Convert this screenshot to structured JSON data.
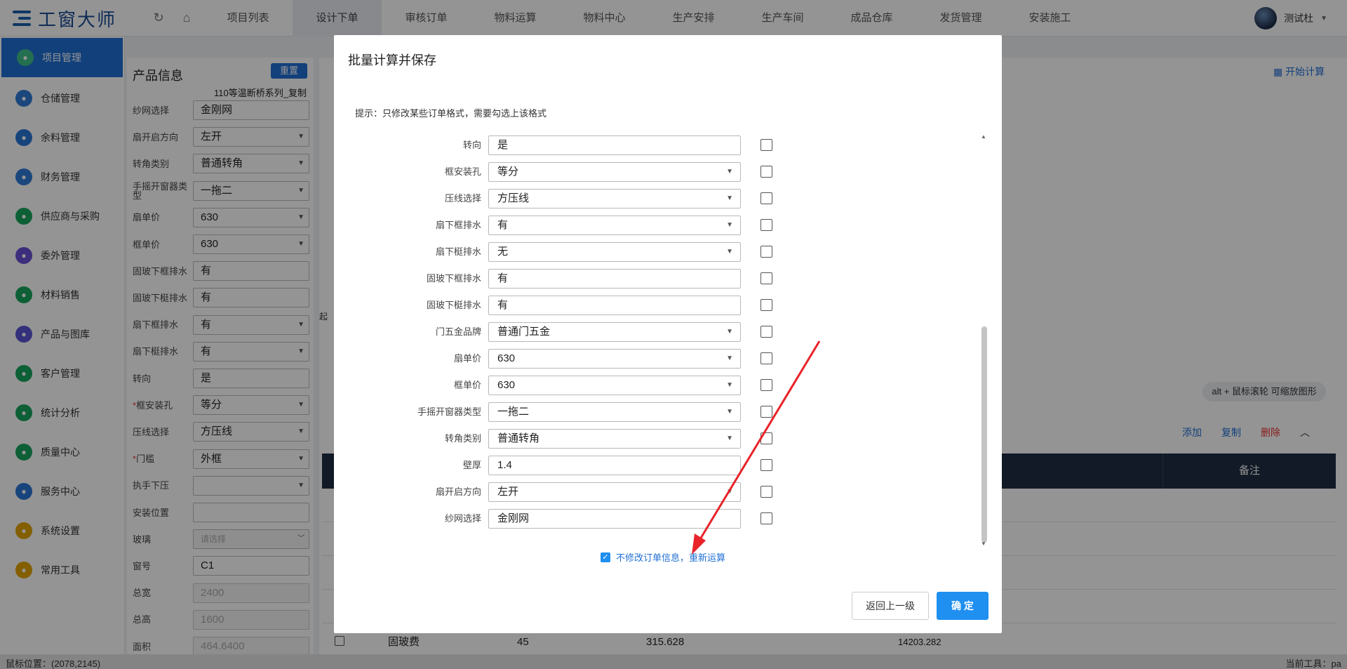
{
  "app": {
    "logo_text": "工窗大师"
  },
  "topnav": {
    "items": [
      "项目列表",
      "设计下单",
      "审核订单",
      "物料运算",
      "物料中心",
      "生产安排",
      "生产车间",
      "成品仓库",
      "发货管理",
      "安装施工"
    ],
    "user": "测试杜"
  },
  "sidebar": {
    "items": [
      {
        "label": "项目管理",
        "color": "#1aa06d"
      },
      {
        "label": "仓储管理",
        "color": "#2f7ad8"
      },
      {
        "label": "余料管理",
        "color": "#2a75d6"
      },
      {
        "label": "财务管理",
        "color": "#2f7ad8"
      },
      {
        "label": "供应商与采购",
        "color": "#18a45c"
      },
      {
        "label": "委外管理",
        "color": "#6a4fd6"
      },
      {
        "label": "材料销售",
        "color": "#18a45c"
      },
      {
        "label": "产品与图库",
        "color": "#5b54d6"
      },
      {
        "label": "客户管理",
        "color": "#18a45c"
      },
      {
        "label": "统计分析",
        "color": "#18a45c"
      },
      {
        "label": "质量中心",
        "color": "#18a45c"
      },
      {
        "label": "服务中心",
        "color": "#2a75d6"
      },
      {
        "label": "系统设置",
        "color": "#e2a400"
      },
      {
        "label": "常用工具",
        "color": "#e2a400"
      }
    ]
  },
  "panel": {
    "title": "产品信息",
    "reset": "重置",
    "series": "110等温断桥系列_复制",
    "fields": [
      {
        "label": "纱网选择",
        "value": "金刚网",
        "select": false
      },
      {
        "label": "扇开启方向",
        "value": "左开",
        "select": true
      },
      {
        "label": "转角类别",
        "value": "普通转角",
        "select": true
      },
      {
        "label": "手摇开窗器类型",
        "value": "一拖二",
        "select": true
      },
      {
        "label": "扇单价",
        "value": "630",
        "select": true
      },
      {
        "label": "框单价",
        "value": "630",
        "select": true
      },
      {
        "label": "固玻下框排水",
        "value": "有",
        "select": false
      },
      {
        "label": "固玻下梃排水",
        "value": "有",
        "select": false
      },
      {
        "label": "扇下框排水",
        "value": "有",
        "select": true
      },
      {
        "label": "扇下梃排水",
        "value": "有",
        "select": true
      },
      {
        "label": "转向",
        "value": "是",
        "select": false
      },
      {
        "label": "框安装孔",
        "value": "等分",
        "select": true,
        "required": true
      },
      {
        "label": "压线选择",
        "value": "方压线",
        "select": true
      },
      {
        "label": "门槛",
        "value": "外框",
        "select": true,
        "required": true
      },
      {
        "label": "执手下压",
        "value": "",
        "select": true
      },
      {
        "label": "安装位置",
        "value": "",
        "select": false
      },
      {
        "label": "玻璃",
        "value": "请选择",
        "select": true,
        "placeholder": true
      },
      {
        "label": "窗号",
        "value": "C1",
        "select": false
      },
      {
        "label": "总宽",
        "value": "2400",
        "select": false,
        "disabled": true
      },
      {
        "label": "总高",
        "value": "1600",
        "select": false,
        "disabled": true
      },
      {
        "label": "面积",
        "value": "464.6400",
        "select": false,
        "disabled": true
      }
    ]
  },
  "main": {
    "start_calc": "开始计算",
    "zoom_hint": "alt + 鼠标滚轮 可缩放图形",
    "actions": {
      "add": "添加",
      "copy": "复制",
      "delete": "删除"
    },
    "remark_header": "备注",
    "partial_label": "起",
    "bottom_row": {
      "name": "固玻费",
      "qty": "45",
      "price": "315.628",
      "total": "14203.282"
    }
  },
  "status": {
    "mouse": "鼠标位置：(2078,2145)",
    "tool": "当前工具：pa"
  },
  "modal": {
    "title": "批量计算并保存",
    "hint": "提示：只修改某些订单格式，需要勾选上该格式",
    "rows": [
      {
        "label": "转向",
        "value": "是",
        "select": false
      },
      {
        "label": "框安装孔",
        "value": "等分",
        "select": true
      },
      {
        "label": "压线选择",
        "value": "方压线",
        "select": true
      },
      {
        "label": "扇下框排水",
        "value": "有",
        "select": true
      },
      {
        "label": "扇下梃排水",
        "value": "无",
        "select": true
      },
      {
        "label": "固玻下框排水",
        "value": "有",
        "select": false
      },
      {
        "label": "固玻下梃排水",
        "value": "有",
        "select": false
      },
      {
        "label": "门五金品牌",
        "value": "普通门五金",
        "select": true
      },
      {
        "label": "扇单价",
        "value": "630",
        "select": true
      },
      {
        "label": "框单价",
        "value": "630",
        "select": true
      },
      {
        "label": "手摇开窗器类型",
        "value": "一拖二",
        "select": true
      },
      {
        "label": "转角类别",
        "value": "普通转角",
        "select": true
      },
      {
        "label": "壁厚",
        "value": "1.4",
        "select": false
      },
      {
        "label": "扇开启方向",
        "value": "左开",
        "select": true
      },
      {
        "label": "纱网选择",
        "value": "金刚网",
        "select": false
      }
    ],
    "recalc_label": "不修改订单信息，重新运算",
    "recalc_checked": true,
    "back_btn": "返回上一级",
    "ok_btn": "确 定",
    "arrow_color": "#e8232a"
  }
}
